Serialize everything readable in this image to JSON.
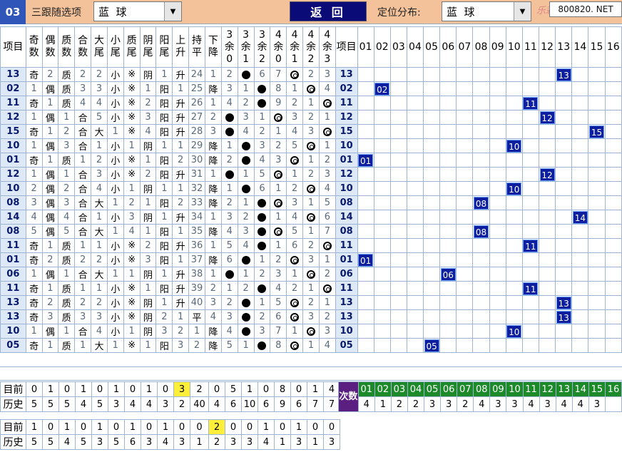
{
  "top": {
    "number": "03",
    "followLabel": "三跟随选项",
    "followSelect": "蓝  球",
    "backButton": "返 回",
    "positionLabel": "定位分布:",
    "positionSelect": "蓝  球",
    "watermark": "乐彩网",
    "site": "800820. NET"
  },
  "headers": {
    "item": "项目",
    "cols": [
      "奇数",
      "偶数",
      "质数",
      "合数",
      "大尾",
      "小尾",
      "质尾",
      "阴尾",
      "阳尾",
      "上升",
      "持平",
      "下降",
      "3余0",
      "3余1",
      "3余2",
      "4余0",
      "4余1",
      "4余2",
      "4余3"
    ],
    "item2": "项目",
    "numbers": [
      "01",
      "02",
      "03",
      "04",
      "05",
      "06",
      "07",
      "08",
      "09",
      "10",
      "11",
      "12",
      "13",
      "14",
      "15",
      "16"
    ]
  },
  "rows": [
    {
      "item": "13",
      "c": [
        "奇",
        "2",
        "质",
        "2",
        "2",
        "小",
        "※",
        "阴",
        "1",
        "升",
        "24",
        "1",
        "2",
        "●",
        "6",
        "7",
        "◎",
        "2",
        "3"
      ],
      "hit": [
        1,
        0,
        1,
        0,
        0,
        1,
        1,
        1,
        0,
        1,
        0,
        0,
        0,
        1,
        0,
        0,
        1,
        0,
        0
      ],
      "pos": 13
    },
    {
      "item": "02",
      "c": [
        "1",
        "偶",
        "质",
        "3",
        "3",
        "小",
        "※",
        "1",
        "阳",
        "1",
        "25",
        "降",
        "3",
        "1",
        "●",
        "8",
        "1",
        "◎",
        "4"
      ],
      "hit": [
        0,
        1,
        1,
        0,
        0,
        1,
        1,
        0,
        1,
        0,
        0,
        1,
        0,
        0,
        1,
        0,
        0,
        1,
        0
      ],
      "pos": 2
    },
    {
      "item": "11",
      "c": [
        "奇",
        "1",
        "质",
        "4",
        "4",
        "小",
        "※",
        "2",
        "阳",
        "升",
        "26",
        "1",
        "4",
        "2",
        "●",
        "9",
        "2",
        "1",
        "◎"
      ],
      "hit": [
        1,
        0,
        1,
        0,
        0,
        1,
        1,
        0,
        1,
        1,
        0,
        0,
        0,
        0,
        1,
        0,
        0,
        0,
        1
      ],
      "pos": 11
    },
    {
      "item": "12",
      "c": [
        "1",
        "偶",
        "1",
        "合",
        "5",
        "小",
        "※",
        "3",
        "阳",
        "升",
        "27",
        "2",
        "●",
        "3",
        "1",
        "◎",
        "3",
        "2",
        "1"
      ],
      "hit": [
        0,
        1,
        0,
        1,
        0,
        1,
        1,
        0,
        1,
        1,
        0,
        0,
        1,
        0,
        0,
        1,
        0,
        0,
        0
      ],
      "pos": 12
    },
    {
      "item": "15",
      "c": [
        "奇",
        "1",
        "2",
        "合",
        "大",
        "1",
        "※",
        "4",
        "阳",
        "升",
        "28",
        "3",
        "●",
        "4",
        "2",
        "1",
        "4",
        "3",
        "◎"
      ],
      "hit": [
        1,
        0,
        0,
        1,
        1,
        0,
        1,
        0,
        1,
        1,
        0,
        0,
        1,
        0,
        0,
        0,
        0,
        0,
        1
      ],
      "pos": 15
    },
    {
      "item": "10",
      "c": [
        "1",
        "偶",
        "3",
        "合",
        "1",
        "小",
        "1",
        "阴",
        "1",
        "1",
        "29",
        "降",
        "1",
        "●",
        "3",
        "2",
        "5",
        "◎",
        "1"
      ],
      "hit": [
        0,
        1,
        0,
        1,
        0,
        1,
        0,
        1,
        0,
        0,
        0,
        1,
        0,
        1,
        0,
        0,
        0,
        1,
        0
      ],
      "pos": 10
    },
    {
      "item": "01",
      "c": [
        "奇",
        "1",
        "质",
        "1",
        "2",
        "小",
        "※",
        "1",
        "阳",
        "2",
        "30",
        "降",
        "2",
        "●",
        "4",
        "3",
        "◎",
        "1",
        "2"
      ],
      "hit": [
        1,
        0,
        1,
        0,
        0,
        1,
        1,
        0,
        1,
        0,
        0,
        1,
        0,
        1,
        0,
        0,
        1,
        0,
        0
      ],
      "pos": 1
    },
    {
      "item": "12",
      "c": [
        "1",
        "偶",
        "1",
        "合",
        "3",
        "小",
        "※",
        "2",
        "阳",
        "升",
        "31",
        "1",
        "●",
        "1",
        "5",
        "◎",
        "1",
        "2",
        "3"
      ],
      "hit": [
        0,
        1,
        0,
        1,
        0,
        1,
        1,
        0,
        1,
        1,
        0,
        0,
        1,
        0,
        0,
        1,
        0,
        0,
        0
      ],
      "pos": 12
    },
    {
      "item": "10",
      "c": [
        "2",
        "偶",
        "2",
        "合",
        "4",
        "小",
        "1",
        "阴",
        "1",
        "1",
        "32",
        "降",
        "1",
        "●",
        "6",
        "1",
        "2",
        "◎",
        "4"
      ],
      "hit": [
        0,
        1,
        0,
        1,
        0,
        1,
        0,
        1,
        0,
        0,
        0,
        1,
        0,
        1,
        0,
        0,
        0,
        1,
        0
      ],
      "pos": 10
    },
    {
      "item": "08",
      "c": [
        "3",
        "偶",
        "3",
        "合",
        "大",
        "1",
        "2",
        "1",
        "阳",
        "2",
        "33",
        "降",
        "2",
        "1",
        "●",
        "◎",
        "3",
        "1",
        "5"
      ],
      "hit": [
        0,
        1,
        0,
        1,
        1,
        0,
        0,
        0,
        1,
        0,
        0,
        1,
        0,
        0,
        1,
        1,
        0,
        0,
        0
      ],
      "pos": 8
    },
    {
      "item": "14",
      "c": [
        "4",
        "偶",
        "4",
        "合",
        "1",
        "小",
        "3",
        "阴",
        "1",
        "升",
        "34",
        "1",
        "3",
        "2",
        "●",
        "1",
        "4",
        "◎",
        "6"
      ],
      "hit": [
        0,
        1,
        0,
        1,
        0,
        1,
        0,
        1,
        0,
        1,
        0,
        0,
        0,
        0,
        1,
        0,
        0,
        1,
        0
      ],
      "pos": 14
    },
    {
      "item": "08",
      "c": [
        "5",
        "偶",
        "5",
        "合",
        "大",
        "1",
        "4",
        "1",
        "阳",
        "1",
        "35",
        "降",
        "4",
        "3",
        "●",
        "◎",
        "5",
        "1",
        "7"
      ],
      "hit": [
        0,
        1,
        0,
        1,
        1,
        0,
        0,
        0,
        1,
        0,
        0,
        1,
        0,
        0,
        1,
        1,
        0,
        0,
        0
      ],
      "pos": 8
    },
    {
      "item": "11",
      "c": [
        "奇",
        "1",
        "质",
        "1",
        "1",
        "小",
        "※",
        "2",
        "阳",
        "升",
        "36",
        "1",
        "5",
        "4",
        "●",
        "1",
        "6",
        "2",
        "◎"
      ],
      "hit": [
        1,
        0,
        1,
        0,
        0,
        1,
        1,
        0,
        1,
        1,
        0,
        0,
        0,
        0,
        1,
        0,
        0,
        0,
        1
      ],
      "pos": 11
    },
    {
      "item": "01",
      "c": [
        "奇",
        "2",
        "质",
        "2",
        "2",
        "小",
        "※",
        "3",
        "阳",
        "1",
        "37",
        "降",
        "6",
        "●",
        "1",
        "2",
        "◎",
        "3",
        "1"
      ],
      "hit": [
        1,
        0,
        1,
        0,
        0,
        1,
        1,
        0,
        1,
        0,
        0,
        1,
        0,
        1,
        0,
        0,
        1,
        0,
        0
      ],
      "pos": 1
    },
    {
      "item": "06",
      "c": [
        "1",
        "偶",
        "1",
        "合",
        "大",
        "1",
        "1",
        "阴",
        "1",
        "升",
        "38",
        "1",
        "●",
        "1",
        "2",
        "3",
        "1",
        "◎",
        "2"
      ],
      "hit": [
        0,
        1,
        0,
        1,
        1,
        0,
        0,
        1,
        0,
        1,
        0,
        0,
        1,
        0,
        0,
        0,
        0,
        1,
        0
      ],
      "pos": 6
    },
    {
      "item": "11",
      "c": [
        "奇",
        "1",
        "质",
        "1",
        "1",
        "小",
        "※",
        "1",
        "阳",
        "升",
        "39",
        "2",
        "1",
        "2",
        "●",
        "4",
        "2",
        "1",
        "◎"
      ],
      "hit": [
        1,
        0,
        1,
        0,
        0,
        1,
        1,
        0,
        1,
        1,
        0,
        0,
        0,
        0,
        1,
        0,
        0,
        0,
        1
      ],
      "pos": 11
    },
    {
      "item": "13",
      "c": [
        "奇",
        "2",
        "质",
        "2",
        "2",
        "小",
        "※",
        "阴",
        "1",
        "升",
        "40",
        "3",
        "2",
        "●",
        "1",
        "5",
        "◎",
        "2",
        "1"
      ],
      "hit": [
        1,
        0,
        1,
        0,
        0,
        1,
        1,
        1,
        0,
        1,
        0,
        0,
        0,
        1,
        0,
        0,
        1,
        0,
        0
      ],
      "pos": 13
    },
    {
      "item": "13",
      "c": [
        "奇",
        "3",
        "质",
        "3",
        "3",
        "小",
        "※",
        "阴",
        "2",
        "1",
        "平",
        "4",
        "3",
        "●",
        "2",
        "6",
        "◎",
        "3",
        "2"
      ],
      "hit": [
        1,
        0,
        1,
        0,
        0,
        1,
        1,
        1,
        0,
        0,
        1,
        0,
        0,
        1,
        0,
        0,
        1,
        0,
        0
      ],
      "pos": 13
    },
    {
      "item": "10",
      "c": [
        "1",
        "偶",
        "1",
        "合",
        "4",
        "小",
        "1",
        "阴",
        "3",
        "2",
        "1",
        "降",
        "4",
        "●",
        "3",
        "7",
        "1",
        "◎",
        "3"
      ],
      "hit": [
        0,
        1,
        0,
        1,
        0,
        1,
        0,
        1,
        0,
        0,
        0,
        1,
        0,
        1,
        0,
        0,
        0,
        1,
        0
      ],
      "pos": 10
    },
    {
      "item": "05",
      "c": [
        "奇",
        "1",
        "质",
        "1",
        "大",
        "1",
        "※",
        "1",
        "阳",
        "3",
        "2",
        "降",
        "5",
        "1",
        "●",
        "8",
        "◎",
        "1",
        "4"
      ],
      "hit": [
        1,
        0,
        1,
        0,
        1,
        0,
        1,
        0,
        1,
        0,
        0,
        1,
        0,
        0,
        1,
        0,
        1,
        0,
        0
      ],
      "pos": 5
    }
  ],
  "stats1": {
    "currentLabel": "目前",
    "historyLabel": "历史",
    "current": [
      "0",
      "1",
      "0",
      "1",
      "0",
      "1",
      "0",
      "1",
      "0",
      "3",
      "2",
      "0",
      "5",
      "1",
      "0",
      "8",
      "0",
      "1",
      "4"
    ],
    "history": [
      "5",
      "5",
      "5",
      "4",
      "5",
      "3",
      "4",
      "4",
      "3",
      "2",
      "40",
      "4",
      "6",
      "10",
      "6",
      "9",
      "6",
      "7",
      "7"
    ],
    "highlightIndex": 9
  },
  "cishu": {
    "label": "次数",
    "numbers": [
      "01",
      "02",
      "03",
      "04",
      "05",
      "06",
      "07",
      "08",
      "09",
      "10",
      "11",
      "12",
      "13",
      "14",
      "15",
      "16"
    ],
    "counts": [
      "4",
      "1",
      "2",
      "2",
      "3",
      "3",
      "2",
      "4",
      "3",
      "3",
      "4",
      "3",
      "4",
      "4",
      "3",
      ""
    ]
  },
  "stats2": {
    "currentLabel": "目前",
    "historyLabel": "历史",
    "current": [
      "1",
      "0",
      "1",
      "0",
      "1",
      "0",
      "1",
      "0",
      "1",
      "0",
      "0",
      "2",
      "0",
      "0",
      "1",
      "0",
      "1",
      "0",
      "0"
    ],
    "history": [
      "5",
      "5",
      "4",
      "5",
      "3",
      "5",
      "6",
      "3",
      "4",
      "3",
      "1",
      "2",
      "3",
      "3",
      "4",
      "1",
      "3",
      "1",
      "3"
    ],
    "highlightIndex": 11
  }
}
